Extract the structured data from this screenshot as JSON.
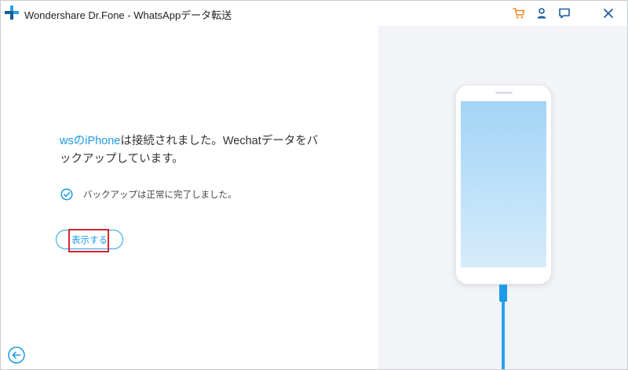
{
  "app": {
    "title": "Wondershare Dr.Fone - WhatsAppデータ転送"
  },
  "titlebar": {
    "icons": [
      "cart-icon",
      "user-icon",
      "feedback-icon",
      "close-icon"
    ]
  },
  "main": {
    "device_name": "wsのiPhone",
    "message_rest": "は接続されました。Wechatデータをバックアップしています。",
    "status_text": "バックアップは正常に完了しました。",
    "show_button_label": "表示する"
  },
  "colors": {
    "accent": "#1e9be6",
    "cart": "#f08a24",
    "highlight": "#d9262c",
    "right_bg": "#f2f4f7"
  }
}
